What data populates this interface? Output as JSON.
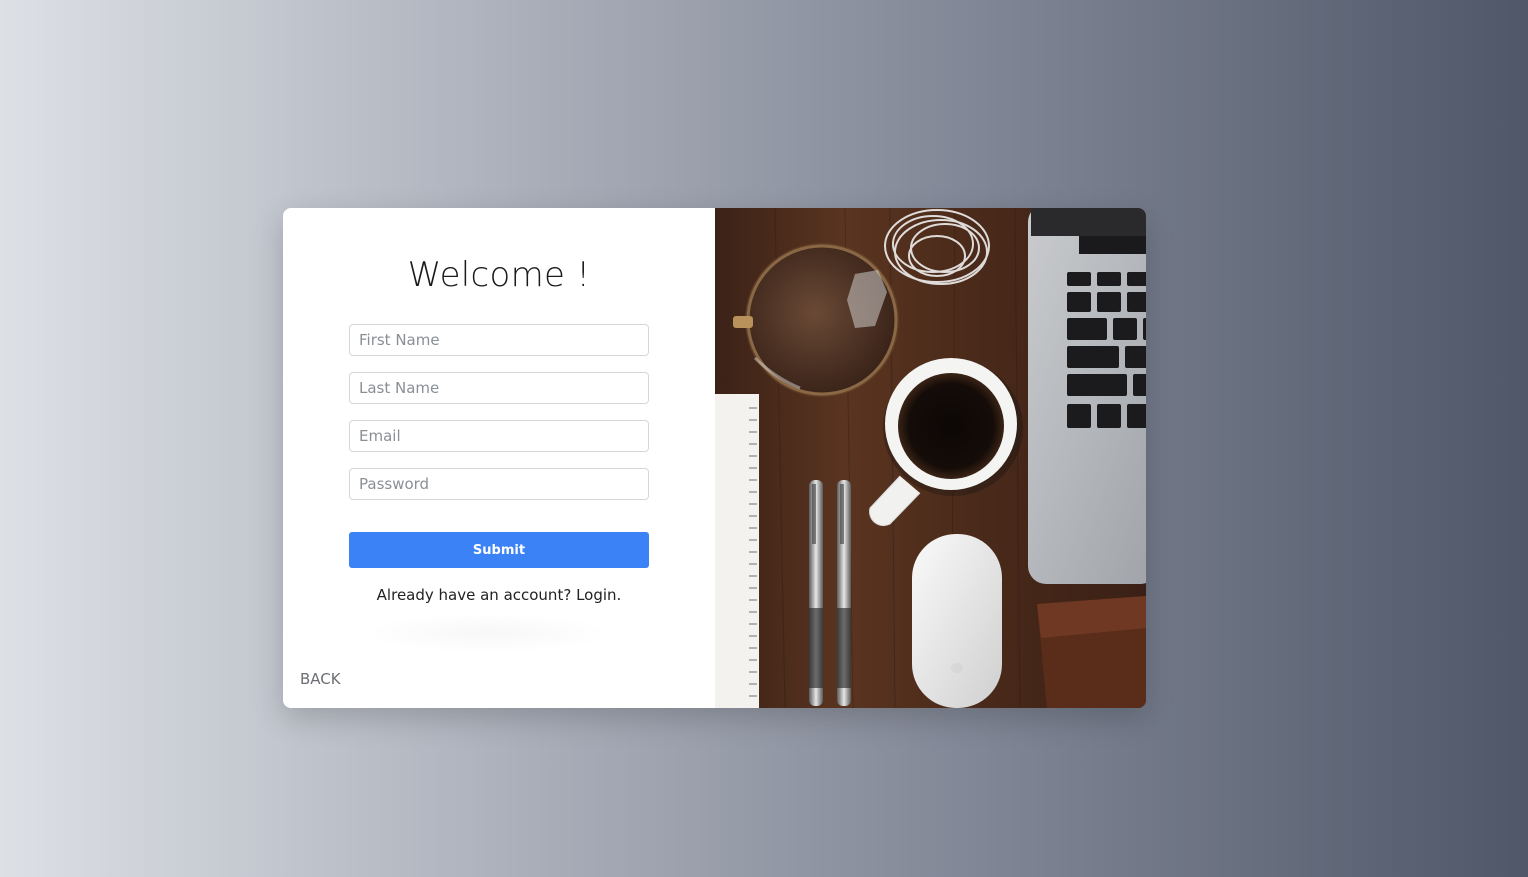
{
  "form": {
    "title": "Welcome !",
    "fields": {
      "first_name_placeholder": "First Name",
      "last_name_placeholder": "Last Name",
      "email_placeholder": "Email",
      "password_placeholder": "Password"
    },
    "submit_label": "Submit",
    "already_text": "Already have an account?",
    "login_link": "Login.",
    "back_label": "BACK"
  },
  "photo": {
    "subject": "desk-with-coffee-laptop-pens-mouse"
  },
  "colors": {
    "accent": "#3b82f6",
    "card_bg": "#ffffff",
    "wood": "#4a2a1a"
  }
}
